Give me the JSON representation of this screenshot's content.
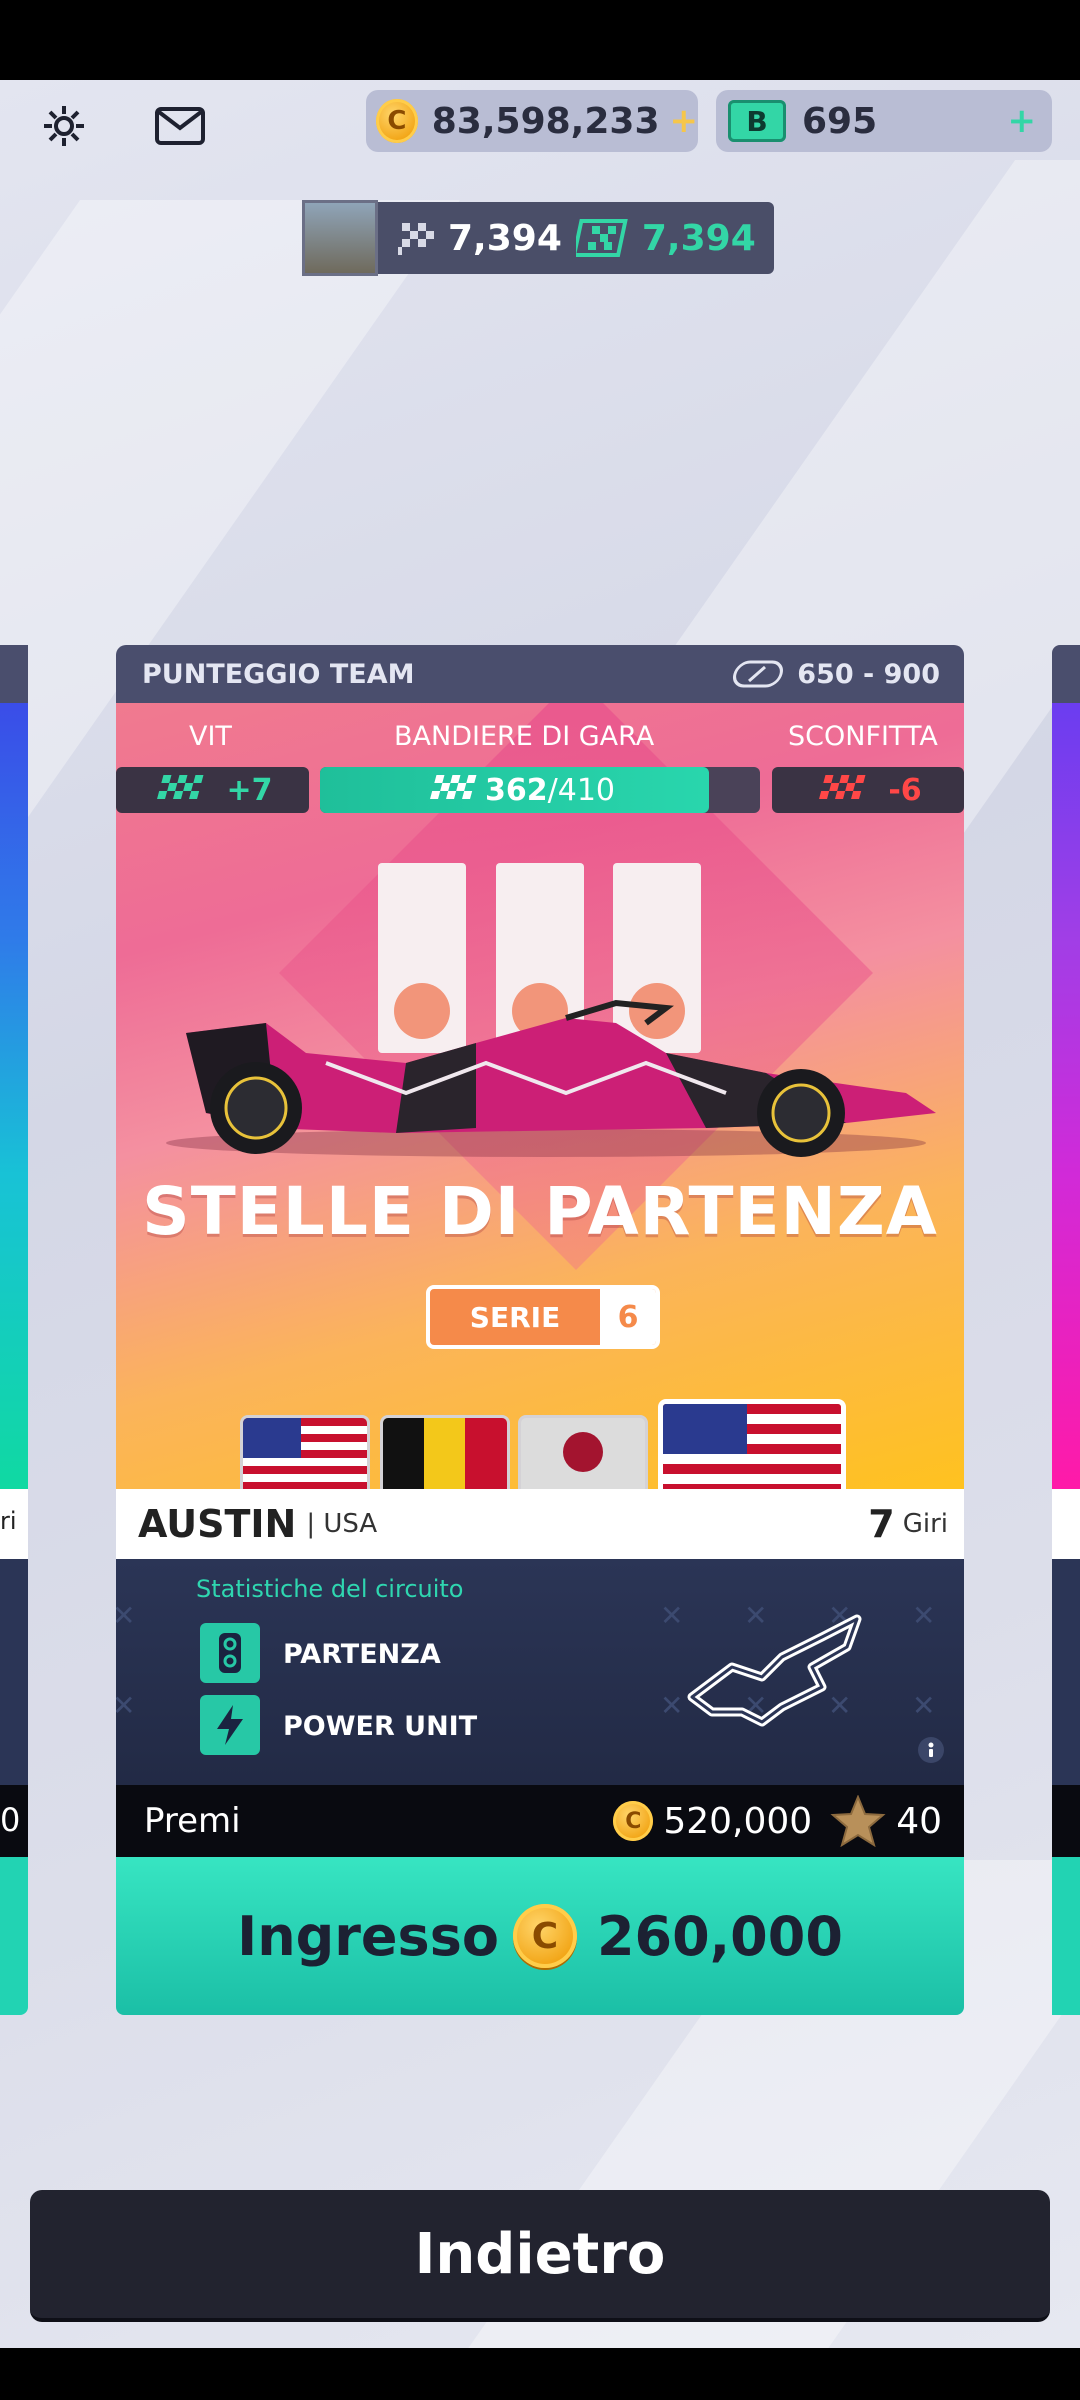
{
  "topbar": {
    "coins": "83,598,233",
    "coins_plus": "+",
    "bucks": "695",
    "bucks_plus": "+",
    "coin_symbol": "C",
    "bucks_symbol": "B"
  },
  "rank": {
    "value_a": "7,394",
    "value_b": "7,394"
  },
  "card": {
    "team_score_label": "PUNTEGGIO TEAM",
    "team_score_range": "650 - 900",
    "win_label": "VIT",
    "flags_label": "BANDIERE DI GARA",
    "loss_label": "SCONFITTA",
    "win_value": "+7",
    "flags_current": "362",
    "flags_total": "/410",
    "flags_progress": 0.883,
    "loss_value": "-6",
    "event_title": "STELLE DI PARTENZA",
    "series_label": "SERIE",
    "series_number": "6",
    "track_name": "AUSTIN",
    "track_country": "| USA",
    "laps_number": "7",
    "laps_label": "Giri",
    "stats_title": "Statistiche del circuito",
    "stat_1": "PARTENZA",
    "stat_2": "POWER UNIT",
    "prizes_label": "Premi",
    "prize_coins": "520,000",
    "prize_stars": "40",
    "entry_label": "Ingresso",
    "entry_cost": "260,000"
  },
  "left_card": {
    "partial_label": "ri",
    "partial_num": "0"
  },
  "back_button": "Indietro",
  "colors": {
    "accent_green": "#27c8a6",
    "loss_red": "#ff4747",
    "gold": "#f2a516"
  }
}
